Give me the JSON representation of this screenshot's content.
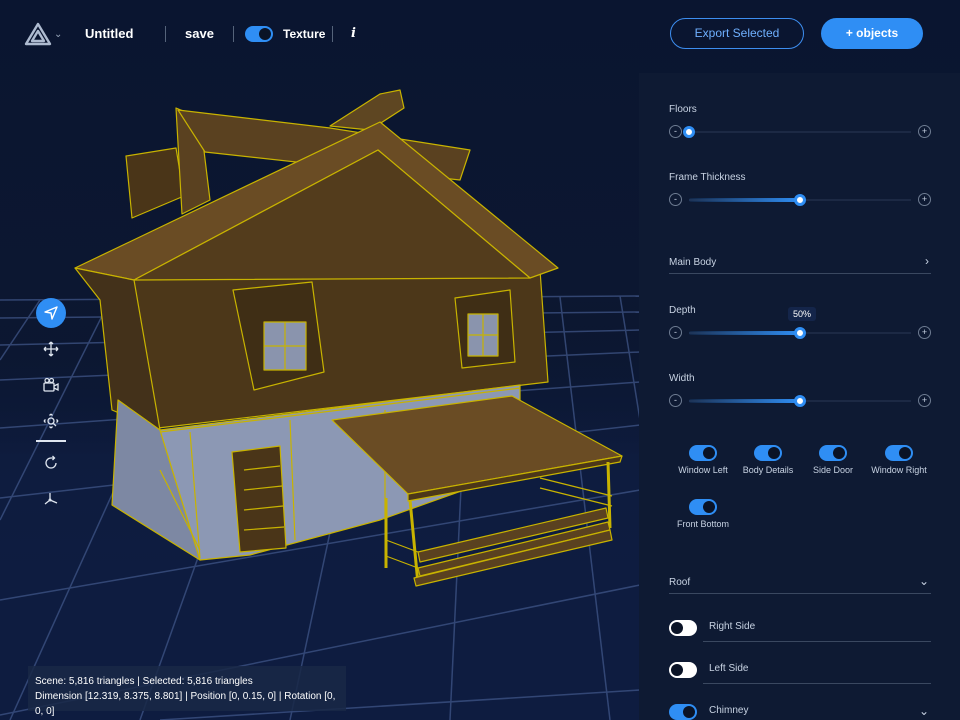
{
  "app": {
    "title": "Untitled",
    "save_label": "save",
    "texture_label": "Texture",
    "texture_enabled": true,
    "info_label": "i",
    "export_label": "Export Selected",
    "add_objects_label": "+ objects"
  },
  "toolbar": {
    "tools": [
      {
        "icon": "select-arrow-icon",
        "active": true
      },
      {
        "icon": "move-icon",
        "active": false
      },
      {
        "icon": "camera-icon",
        "active": false
      },
      {
        "icon": "zoom-icon",
        "active": false
      },
      {
        "icon": "rotate-icon",
        "active": false
      },
      {
        "icon": "axes-icon",
        "active": false
      }
    ]
  },
  "status": {
    "line1": "Scene: 5,816 triangles | Selected: 5,816 triangles",
    "line2": "Dimension [12.319, 8.375, 8.801] | Position [0, 0.15, 0] | Rotation [0, 0, 0]"
  },
  "panel": {
    "floors": {
      "label": "Floors",
      "value": 0
    },
    "frame_thickness": {
      "label": "Frame Thickness",
      "value": 0.5
    },
    "main_body": {
      "label": "Main Body"
    },
    "depth": {
      "label": "Depth",
      "value": 0.5,
      "tooltip": "50%"
    },
    "width": {
      "label": "Width",
      "value": 0.5
    },
    "toggles": [
      {
        "label": "Window Left",
        "on": true
      },
      {
        "label": "Body Details",
        "on": true
      },
      {
        "label": "Side Door",
        "on": true
      },
      {
        "label": "Window Right",
        "on": true
      },
      {
        "label": "Front Bottom",
        "on": true
      }
    ],
    "roof": {
      "label": "Roof"
    },
    "roof_items": [
      {
        "label": "Right Side",
        "on": false
      },
      {
        "label": "Left Side",
        "on": false
      },
      {
        "label": "Chimney",
        "on": true
      }
    ]
  },
  "colors": {
    "accent": "#2f8ef4",
    "panel_bg": "#0e1a33",
    "background": "#0a1326",
    "house_wood": "#5a4120",
    "house_outline": "#c8b300",
    "house_wall": "#8c98b4"
  }
}
